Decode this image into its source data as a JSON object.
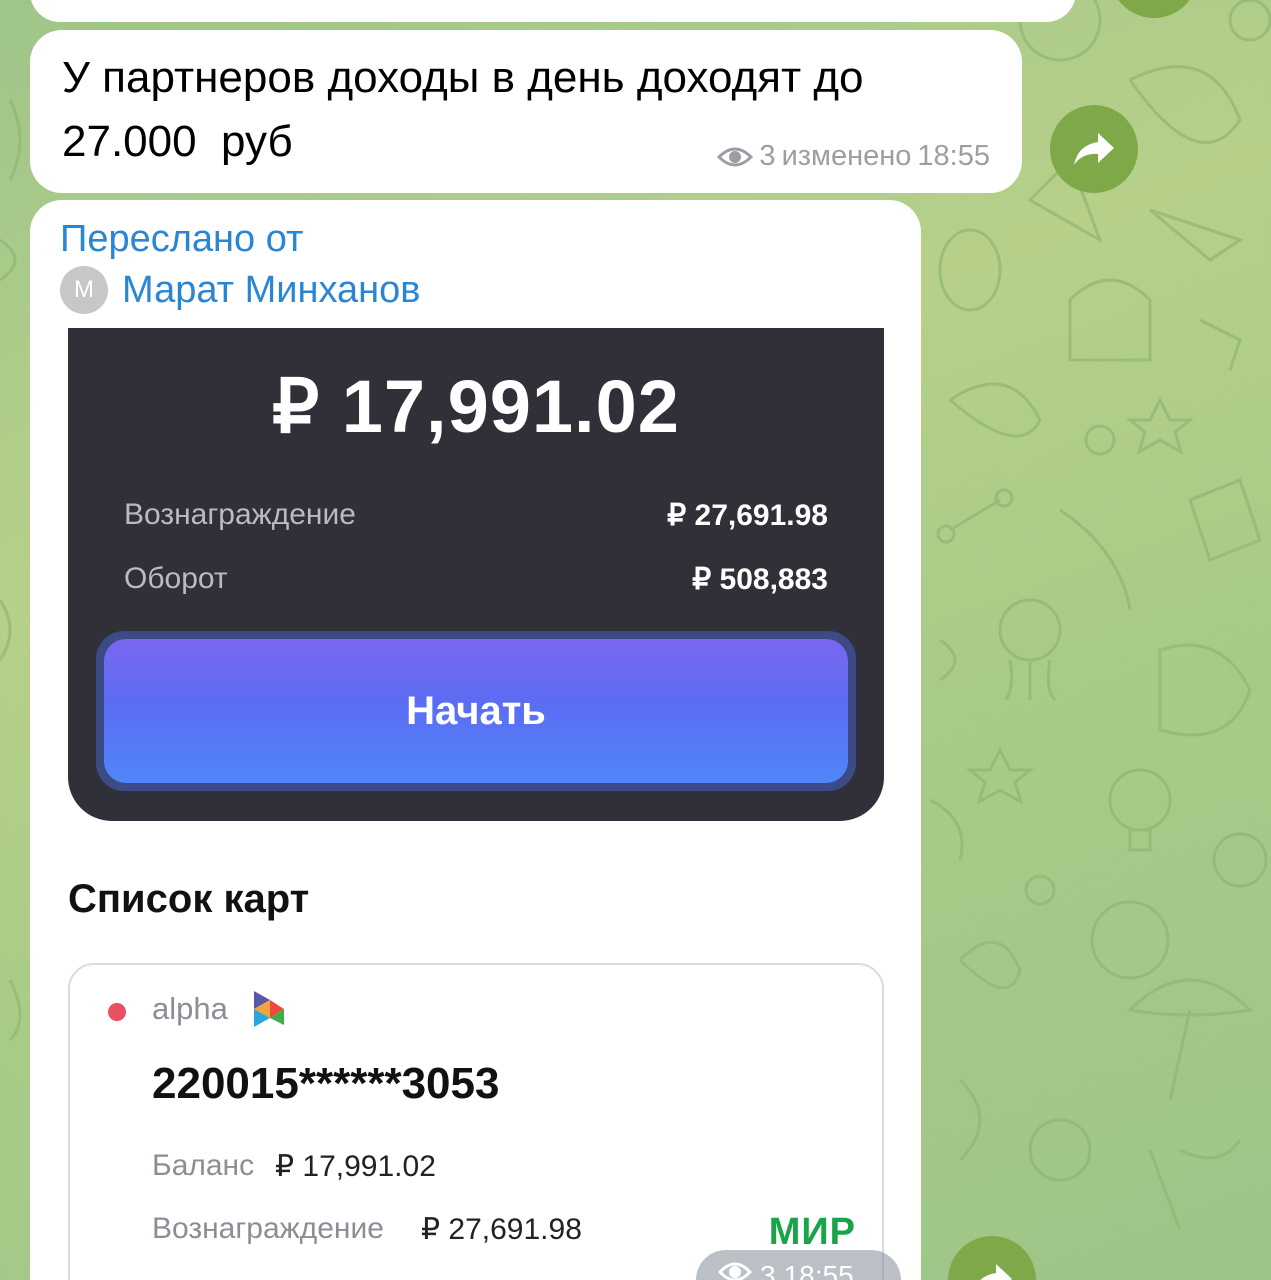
{
  "message": {
    "text": "У партнеров доходы в день доходят до\n27.000  руб",
    "views": "3",
    "edited_label": "изменено",
    "time": "18:55"
  },
  "forwarded": {
    "label": "Переслано от",
    "avatar_letter": "M",
    "author": "Марат Минханов",
    "balance_card": {
      "amount": "₽ 17,991.02",
      "reward_label": "Вознаграждение",
      "reward_value": "₽ 27,691.98",
      "turnover_label": "Оборот",
      "turnover_value": "₽ 508,883",
      "start_button": "Начать"
    },
    "cards_title": "Список карт",
    "card": {
      "bank": "alpha",
      "number": "220015******3053",
      "balance_label": "Баланс",
      "balance_value": "₽ 17,991.02",
      "reward_label": "Вознаграждение",
      "reward_value": "₽ 27,691.98",
      "payment_system": "МИР"
    },
    "meta": {
      "views": "3",
      "time": "18:55"
    }
  },
  "colors": {
    "accent_link": "#2a86d4",
    "share_button": "#7fa849",
    "dark_card": "#303138",
    "mir_green": "#1aa44a"
  }
}
